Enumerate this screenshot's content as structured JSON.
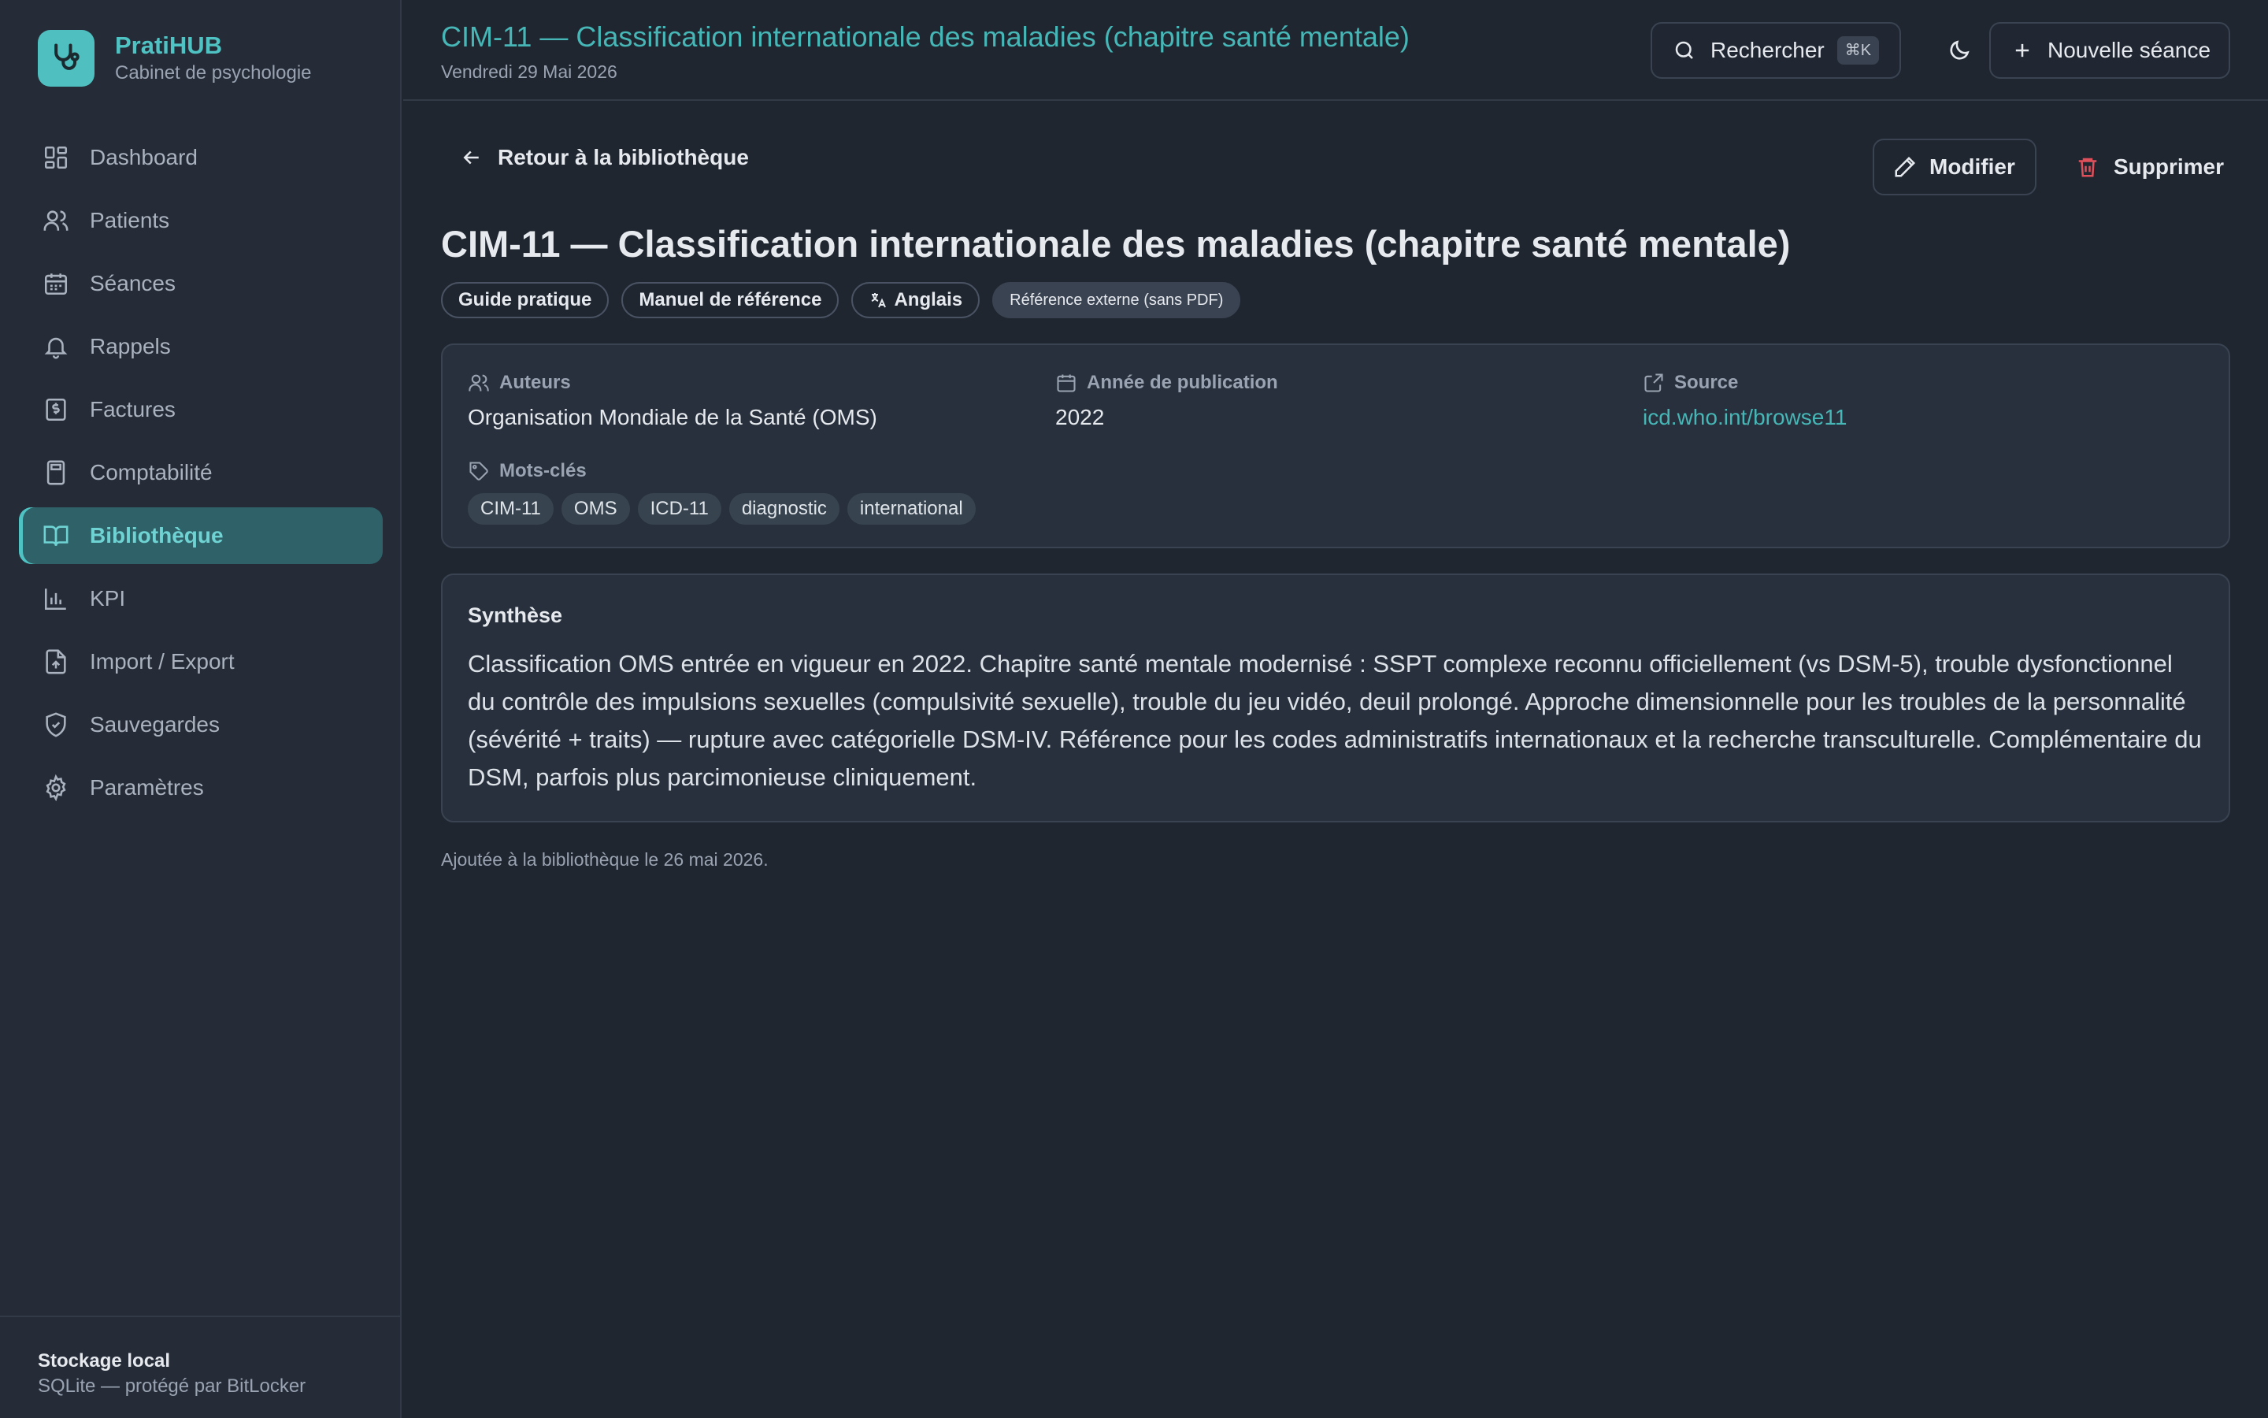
{
  "app": {
    "name": "PratiHUB",
    "subtitle": "Cabinet de psychologie"
  },
  "sidebar": {
    "items": [
      {
        "label": "Dashboard",
        "icon": "dashboard-icon",
        "active": false
      },
      {
        "label": "Patients",
        "icon": "users-icon",
        "active": false
      },
      {
        "label": "Séances",
        "icon": "calendar-icon",
        "active": false
      },
      {
        "label": "Rappels",
        "icon": "bell-icon",
        "active": false
      },
      {
        "label": "Factures",
        "icon": "invoice-icon",
        "active": false
      },
      {
        "label": "Comptabilité",
        "icon": "calculator-icon",
        "active": false
      },
      {
        "label": "Bibliothèque",
        "icon": "book-icon",
        "active": true
      },
      {
        "label": "KPI",
        "icon": "bar-chart-icon",
        "active": false
      },
      {
        "label": "Import / Export",
        "icon": "file-transfer-icon",
        "active": false
      },
      {
        "label": "Sauvegardes",
        "icon": "shield-icon",
        "active": false
      },
      {
        "label": "Paramètres",
        "icon": "gear-icon",
        "active": false
      }
    ],
    "footer": {
      "title": "Stockage local",
      "subtitle": "SQLite — protégé par BitLocker"
    }
  },
  "header": {
    "title": "CIM-11 — Classification internationale des maladies (chapitre santé mentale)",
    "date": "Vendredi 29 Mai 2026",
    "search_label": "Rechercher",
    "search_shortcut": "⌘K",
    "new_session_label": "Nouvelle séance"
  },
  "main": {
    "back_label": "Retour à la bibliothèque",
    "edit_label": "Modifier",
    "delete_label": "Supprimer",
    "title": "CIM-11 — Classification internationale des maladies (chapitre santé mentale)",
    "badges": [
      "Guide pratique",
      "Manuel de référence",
      "Anglais",
      "Référence externe (sans PDF)"
    ],
    "meta": {
      "authors_label": "Auteurs",
      "authors_value": "Organisation Mondiale de la Santé (OMS)",
      "year_label": "Année de publication",
      "year_value": "2022",
      "source_label": "Source",
      "source_value": "icd.who.int/browse11"
    },
    "keywords_label": "Mots-clés",
    "keywords": [
      "CIM-11",
      "OMS",
      "ICD-11",
      "diagnostic",
      "international"
    ],
    "summary_title": "Synthèse",
    "summary_text": "Classification OMS entrée en vigueur en 2022. Chapitre santé mentale modernisé : SSPT complexe reconnu officiellement (vs DSM-5), trouble dysfonctionnel du contrôle des impulsions sexuelles (compulsivité sexuelle), trouble du jeu vidéo, deuil prolongé. Approche dimensionnelle pour les troubles de la personnalité (sévérité + traits) — rupture avec catégorielle DSM-IV. Référence pour les codes administratifs internationaux et la recherche transculturelle. Complémentaire du DSM, parfois plus parcimonieuse cliniquement.",
    "added_note": "Ajoutée à la bibliothèque le 26 mai 2026."
  },
  "colors": {
    "accent": "#4fc3c3",
    "background": "#1f2630",
    "sidebar": "#252c38",
    "danger": "#e0505a"
  }
}
